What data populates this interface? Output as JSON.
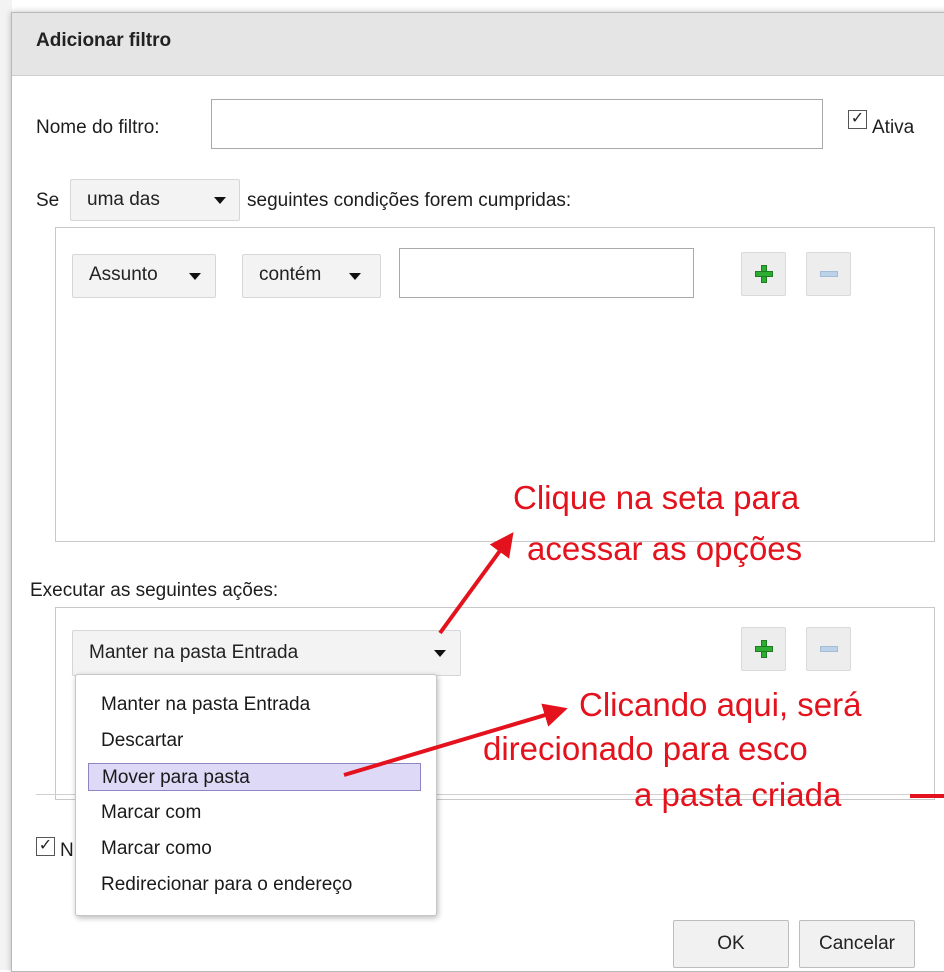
{
  "dialog": {
    "title": "Adicionar filtro",
    "filter_name_label": "Nome do filtro:",
    "filter_name_value": "",
    "active_checked": true,
    "active_label": "Ativa"
  },
  "conditions": {
    "prefix": "Se",
    "match_select": "uma das",
    "suffix": "seguintes condições forem cumpridas:",
    "field_select": "Assunto",
    "operator_select": "contém",
    "value": ""
  },
  "actions": {
    "label": "Executar as seguintes ações:",
    "action_select": "Manter na pasta Entrada",
    "options": [
      "Manter na pasta Entrada",
      "Descartar",
      "Mover para pasta",
      "Marcar com",
      "Marcar como",
      "Redirecionar para o endereço"
    ],
    "selected_option": "Mover para pasta"
  },
  "footer": {
    "checkbox_checked": true,
    "checkbox_label_partial": "N",
    "ok_label": "OK",
    "cancel_label": "Cancelar"
  },
  "annotations": {
    "note1_line1": "Clique na seta para",
    "note1_line2": "acessar as opções",
    "note2_line1": "Clicando aqui, será",
    "note2_line2": "direcionado para esco",
    "note2_line3": "a pasta criada",
    "color": "#e3121c"
  },
  "icons": {
    "add": "plus-icon",
    "remove": "minus-icon",
    "check": "✓"
  }
}
